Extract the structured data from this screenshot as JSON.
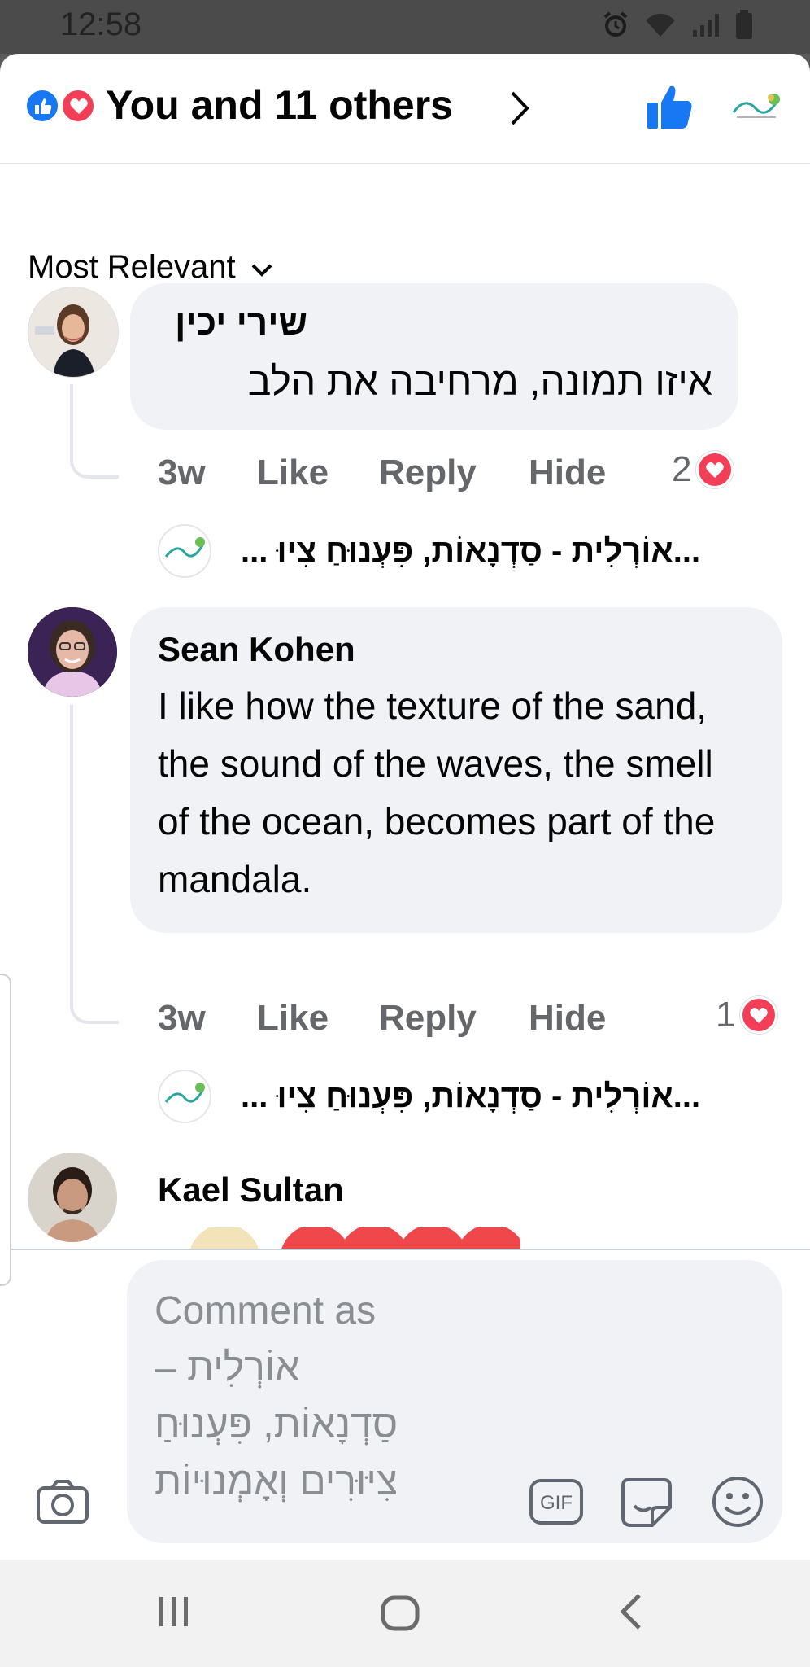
{
  "status_bar": {
    "time": "12:58"
  },
  "header": {
    "reactors_text": "You and 11 others",
    "reaction_icons": [
      "like-icon",
      "love-icon"
    ]
  },
  "sort": {
    "label": "Most Relevant"
  },
  "comments": [
    {
      "author": "שירי יכין",
      "text": "איזו תמונה, מרחיבה את הלב",
      "time": "3w",
      "like_label": "Like",
      "reply_label": "Reply",
      "hide_label": "Hide",
      "reaction_count": "2",
      "reply_preview": "... אוֹרְלִית - סַדְנָאוֹת, פִּעְנוּחַ צִיוּ..."
    },
    {
      "author": "Sean Kohen",
      "text": "I like how the texture of the sand, the sound of the waves, the smell of the ocean, becomes part of the mandala.",
      "time": "3w",
      "like_label": "Like",
      "reply_label": "Reply",
      "hide_label": "Hide",
      "reaction_count": "1",
      "reply_preview": "... אוֹרְלִית - סַדְנָאוֹת, פִּעְנוּחַ צִיוּ..."
    },
    {
      "author": "Kael Sultan"
    }
  ],
  "composer": {
    "placeholder_lines": [
      "Comment as",
      "אוֹרְלִית –",
      "סַדְנָאוֹת, פִּעְנוּחַ",
      "צִיּוּרִים וְאָמְנוּיוֹת"
    ],
    "gif_label": "GIF"
  },
  "colors": {
    "accent": "#1877f2",
    "love": "#f33e58",
    "bubble": "#f0f2f5",
    "muted": "#65676b"
  }
}
